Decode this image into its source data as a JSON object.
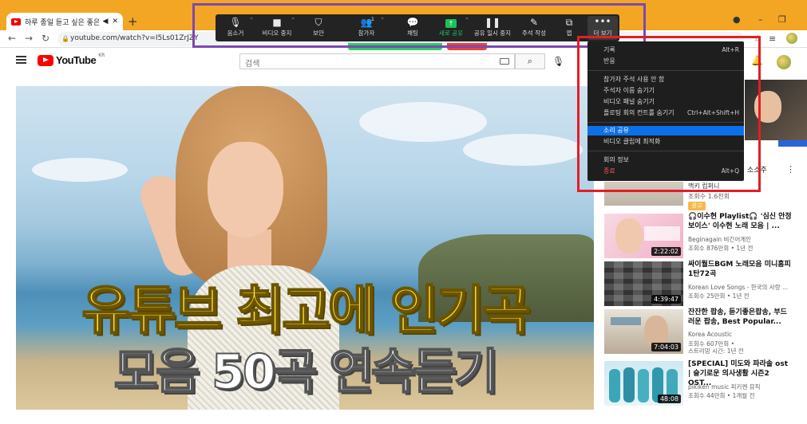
{
  "browser": {
    "tab_title": "하루 종일 듣고 싶은 좋은노",
    "url": "youtube.com/watch?v=I5Ls01ZrJZY"
  },
  "youtube": {
    "logo": "YouTube",
    "region": "KR",
    "search_placeholder": "검색"
  },
  "video": {
    "headline_1": "유튜브 최고에 인기곡",
    "headline_2": "모음 50곡 연속듣기"
  },
  "zoom_toolbar": {
    "items": [
      {
        "icon": "mic-icon",
        "label": "음소거"
      },
      {
        "icon": "video-icon",
        "label": "비디오 중지"
      },
      {
        "icon": "shield-icon",
        "label": "보안"
      },
      {
        "icon": "participants-icon",
        "label": "참가자",
        "count": "1"
      },
      {
        "icon": "chat-icon",
        "label": "채팅"
      },
      {
        "icon": "share-icon",
        "label": "새로 공유"
      },
      {
        "icon": "pause-icon",
        "label": "공유 일시 중지"
      },
      {
        "icon": "pencil-icon",
        "label": "주석 작성"
      },
      {
        "icon": "apps-icon",
        "label": "앱"
      },
      {
        "icon": "more-icon",
        "label": "더 보기"
      }
    ],
    "accent": "#1ec05a"
  },
  "more_menu": {
    "items": [
      {
        "label": "기록",
        "shortcut": "Alt+R"
      },
      {
        "label": "반응",
        "shortcut": ""
      },
      {
        "label": "참가자 주석 사용 안 함",
        "shortcut": ""
      },
      {
        "label": "주석자 이름 숨기기",
        "shortcut": ""
      },
      {
        "label": "비디오 패널 숨기기",
        "shortcut": ""
      },
      {
        "label": "플로팅 회의 컨트롤 숨기기",
        "shortcut": "Ctrl+Alt+Shift+H"
      },
      {
        "label": "소리 공유",
        "shortcut": "",
        "selected": true
      },
      {
        "label": "비디오 클립에 최적화",
        "shortcut": ""
      },
      {
        "label": "회의 정보",
        "shortcut": ""
      },
      {
        "label": "종료",
        "shortcut": "Alt+Q"
      }
    ],
    "selected_color": "#0e70e8"
  },
  "sidebar": {
    "top_partial_title": "소소주",
    "ad": {
      "line1": "맥키 컴퍼니",
      "line2": "조회수 1.6천회",
      "badge": "광고"
    },
    "recommendations": [
      {
        "title": "🎧이수현 Playlist🎧 '심신 안정 보이스' 이수현 노래 모음  |  ...",
        "channel": "Beginagain 비긴어게인",
        "meta": "조회수 876만회 • 1년 전",
        "meta2": "",
        "duration": "2:22:02"
      },
      {
        "title": "싸이월드BGM 노래모음 미니홈피 1탄72곡",
        "channel": "Korean Love Songs - 한국의 사랑 ...",
        "meta": "조회수 25만회 • 1년 전",
        "meta2": "",
        "duration": "4:39:47"
      },
      {
        "title": "잔잔한 팝송, 듣기좋은팝송, 부드러운 팝송, Best Popular...",
        "channel": "Korea Acoustic",
        "meta": "조회수 607만회 •",
        "meta2": "스트리밍 시간: 1년 전",
        "duration": "7:04:03"
      },
      {
        "title": "[SPECIAL] 미도와 파라솔 ost | 슬기로운 의사생활 시즌2 OST...",
        "channel": "pikiken music 피키켄 뮤직",
        "meta": "조회수 44만회 • 1개월 전",
        "meta2": "",
        "duration": "48:08"
      }
    ]
  }
}
